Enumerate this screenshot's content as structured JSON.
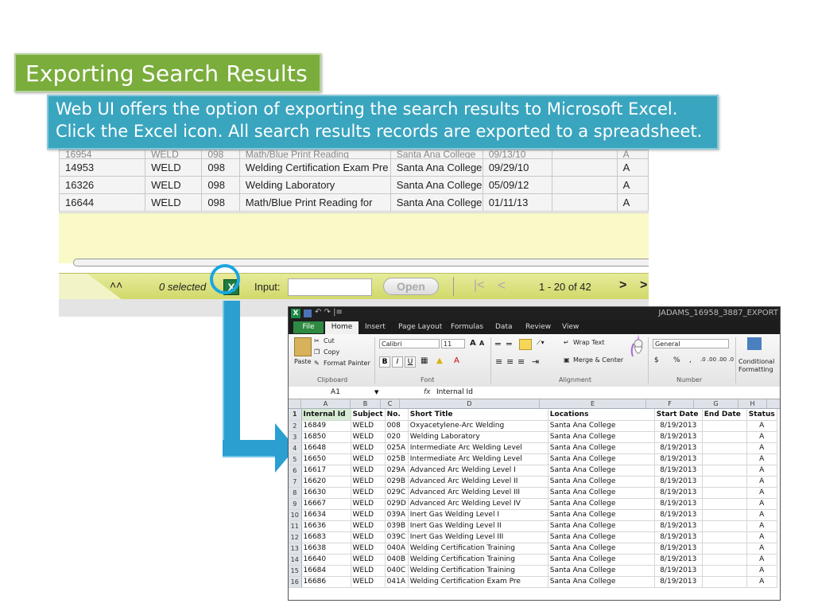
{
  "slide": {
    "title": "Exporting Search Results",
    "callout_line1": "Web UI offers the option of exporting the search results to Microsoft Excel.",
    "callout_line2": "Click the Excel icon. All search results records are exported to a spreadsheet."
  },
  "webui": {
    "rows": [
      [
        "16954",
        "WELD",
        "098",
        "Math/Blue Print Reading",
        "Santa Ana College",
        "09/13/10",
        "",
        "A"
      ],
      [
        "14953",
        "WELD",
        "098",
        "Welding Certification Exam Pre",
        "Santa Ana College",
        "09/29/10",
        "",
        "A"
      ],
      [
        "16326",
        "WELD",
        "098",
        "Welding Laboratory",
        "Santa Ana College",
        "05/09/12",
        "",
        "A"
      ],
      [
        "16644",
        "WELD",
        "098",
        "Math/Blue Print Reading for",
        "Santa Ana College",
        "01/11/13",
        "",
        "A"
      ]
    ],
    "pager": {
      "collapse_icon": "double-chevron-up-icon",
      "selected_text": "0 selected",
      "excel_icon": "excel-export-icon",
      "input_label": "Input:",
      "input_value": "",
      "open_label": "Open",
      "first_glyph": "|<",
      "prev_glyph": "<",
      "range_text": "1 - 20 of 42",
      "next_glyph": ">",
      "last_glyph": ">"
    },
    "highlight_color": "#1aa6e0"
  },
  "excel": {
    "window_title": "JADAMS_16958_3887_EXPORT",
    "tabs": [
      "File",
      "Home",
      "Insert",
      "Page Layout",
      "Formulas",
      "Data",
      "Review",
      "View"
    ],
    "clipboard": {
      "paste": "Paste",
      "cut": "Cut",
      "copy": "Copy",
      "format_painter": "Format Painter",
      "group": "Clipboard"
    },
    "font": {
      "name": "Calibri",
      "size": "11",
      "group": "Font",
      "grow": "A",
      "shrink": "A",
      "bold": "B",
      "italic": "I",
      "underline": "U"
    },
    "alignment": {
      "wrap": "Wrap Text",
      "merge": "Merge & Center",
      "group": "Alignment"
    },
    "number": {
      "format": "General",
      "currency": "$",
      "percent": "%",
      "comma": ",",
      "group": "Number",
      "inc": ".0 .00",
      "dec": ".00 .0"
    },
    "styles": {
      "conditional": "Conditional",
      "formatting": "Formatting"
    },
    "name_box": "A1",
    "fx": "fx",
    "formula_value": "Internal Id",
    "columns": [
      "A",
      "B",
      "C",
      "D",
      "E",
      "F",
      "G",
      "H"
    ],
    "header": [
      "Internal Id",
      "Subject",
      "No.",
      "Short Title",
      "Locations",
      "Start Date",
      "End Date",
      "Status"
    ],
    "rows": [
      [
        "16849",
        "WELD",
        "008",
        "Oxyacetylene-Arc Welding",
        "Santa Ana College",
        "8/19/2013",
        "",
        "A"
      ],
      [
        "16850",
        "WELD",
        "020",
        "Welding Laboratory",
        "Santa Ana College",
        "8/19/2013",
        "",
        "A"
      ],
      [
        "16648",
        "WELD",
        "025A",
        "Intermediate Arc Welding Level",
        "Santa Ana College",
        "8/19/2013",
        "",
        "A"
      ],
      [
        "16650",
        "WELD",
        "025B",
        "Intermediate Arc Welding Level",
        "Santa Ana College",
        "8/19/2013",
        "",
        "A"
      ],
      [
        "16617",
        "WELD",
        "029A",
        "Advanced Arc Welding Level I",
        "Santa Ana College",
        "8/19/2013",
        "",
        "A"
      ],
      [
        "16620",
        "WELD",
        "029B",
        "Advanced Arc Welding Level II",
        "Santa Ana College",
        "8/19/2013",
        "",
        "A"
      ],
      [
        "16630",
        "WELD",
        "029C",
        "Advanced Arc Welding Level III",
        "Santa Ana College",
        "8/19/2013",
        "",
        "A"
      ],
      [
        "16667",
        "WELD",
        "029D",
        "Advanced Arc Welding Level IV",
        "Santa Ana College",
        "8/19/2013",
        "",
        "A"
      ],
      [
        "16634",
        "WELD",
        "039A",
        "Inert Gas Welding Level I",
        "Santa Ana College",
        "8/19/2013",
        "",
        "A"
      ],
      [
        "16636",
        "WELD",
        "039B",
        "Inert Gas Welding Level II",
        "Santa Ana College",
        "8/19/2013",
        "",
        "A"
      ],
      [
        "16683",
        "WELD",
        "039C",
        "Inert Gas Welding Level III",
        "Santa Ana College",
        "8/19/2013",
        "",
        "A"
      ],
      [
        "16638",
        "WELD",
        "040A",
        "Welding Certification Training",
        "Santa Ana College",
        "8/19/2013",
        "",
        "A"
      ],
      [
        "16640",
        "WELD",
        "040B",
        "Welding Certification Training",
        "Santa Ana College",
        "8/19/2013",
        "",
        "A"
      ],
      [
        "16684",
        "WELD",
        "040C",
        "Welding Certification Training",
        "Santa Ana College",
        "8/19/2013",
        "",
        "A"
      ],
      [
        "16686",
        "WELD",
        "041A",
        "Welding Certification Exam Pre",
        "Santa Ana College",
        "8/19/2013",
        "",
        "A"
      ]
    ],
    "colors": {
      "file_tab": "#2e8a42",
      "title_bar": "#1f1f1f"
    }
  }
}
